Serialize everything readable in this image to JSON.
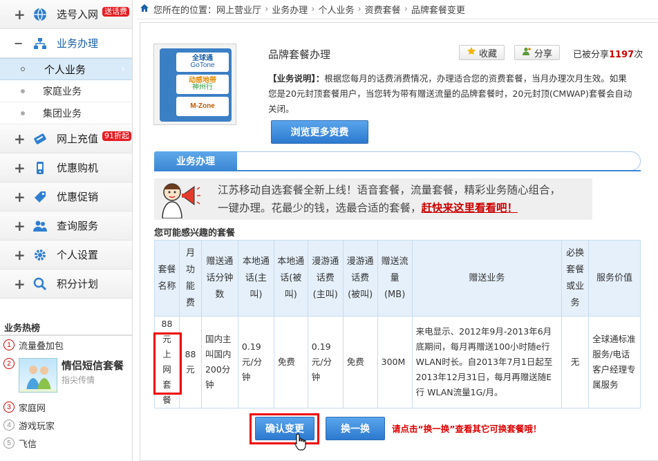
{
  "sidebar": {
    "menu": [
      {
        "label": "选号入网",
        "badge": "送话费",
        "icon": "globe-icon",
        "open": false
      },
      {
        "label": "业务办理",
        "badge": "",
        "icon": "sitemap-icon",
        "open": true
      },
      {
        "label": "网上充值",
        "badge": "91折起",
        "icon": "card-icon",
        "open": false
      },
      {
        "label": "优惠购机",
        "badge": "",
        "icon": "phone-icon",
        "open": false
      },
      {
        "label": "优惠促销",
        "badge": "",
        "icon": "tag-icon",
        "open": false
      },
      {
        "label": "查询服务",
        "badge": "",
        "icon": "people-icon",
        "open": false
      },
      {
        "label": "个人设置",
        "badge": "",
        "icon": "gear-icon",
        "open": false
      },
      {
        "label": "积分计划",
        "badge": "",
        "icon": "search-user-icon",
        "open": false
      }
    ],
    "sub_items": [
      "个人业务",
      "家庭业务",
      "集团业务"
    ],
    "hot_title": "业务热榜",
    "hot_list": [
      {
        "num": "1",
        "label": "流量叠加包"
      },
      {
        "num": "2",
        "label": "情侣短信套餐",
        "sub": "指尖传情"
      },
      {
        "num": "3",
        "label": "家庭网"
      },
      {
        "num": "4",
        "label": "游戏玩家"
      },
      {
        "num": "5",
        "label": "飞信"
      }
    ]
  },
  "breadcrumb": {
    "prefix": "您所在的位置：",
    "items": [
      "网上营业厅",
      "业务办理",
      "个人业务",
      "资费套餐",
      "品牌套餐变更"
    ]
  },
  "product": {
    "logos": [
      "全球通",
      "GoTone",
      "动感地带",
      "神州行",
      "M-Zone"
    ],
    "title": "品牌套餐办理",
    "collect": "收藏",
    "share": "分享",
    "share_prefix": "已被分享",
    "share_count": "1197",
    "share_suffix": "次",
    "desc_label": "【业务说明】：",
    "desc_text": "根据您每月的话费消费情况，办理适合您的资费套餐，当月办理次月生效。如果您是20元封顶套餐用户，当您转为带有赠送流量的品牌套餐时，20元封顶(CMWAP)套餐会自动关闭。",
    "browse": "浏览更多资费"
  },
  "section": {
    "tab": "业务办理",
    "promo_line1": "江苏移动自选套餐全新上线！语音套餐，流量套餐，精彩业务随心组合，",
    "promo_line2": "一键办理。花最少的钱，选最合适的套餐，",
    "promo_link": "赶快来这里看看吧！",
    "table_title": "您可能感兴趣的套餐"
  },
  "table": {
    "headers": [
      "套餐名称",
      "月功能费",
      "赠送通话分钟数",
      "本地通话(主叫)",
      "本地通话(被叫)",
      "漫游通话费(主叫)",
      "漫游通话费(被叫)",
      "赠送流量(MB)",
      "赠送业务",
      "必换套餐或业务",
      "服务价值"
    ],
    "row": [
      "88元上网套餐",
      "88元",
      "国内主叫国内200分钟",
      "0.19元/分钟",
      "免费",
      "0.19元/分钟",
      "免费",
      "300M",
      "来电显示、2012年9月-2013年6月底期间，每月再赠送100小时随e行 WLAN时长。自2013年7月1日起至2013年12月31日，每月再赠送随E行 WLAN流量1G/月。",
      "无",
      "全球通标准服务/电话客户经理专属服务"
    ]
  },
  "actions": {
    "confirm": "确认变更",
    "switch": "换一换",
    "hint": "请点击“换一换”查看其它可换套餐哦！"
  },
  "colors": {
    "accent": "#3b86d4",
    "alert": "#e00000"
  }
}
